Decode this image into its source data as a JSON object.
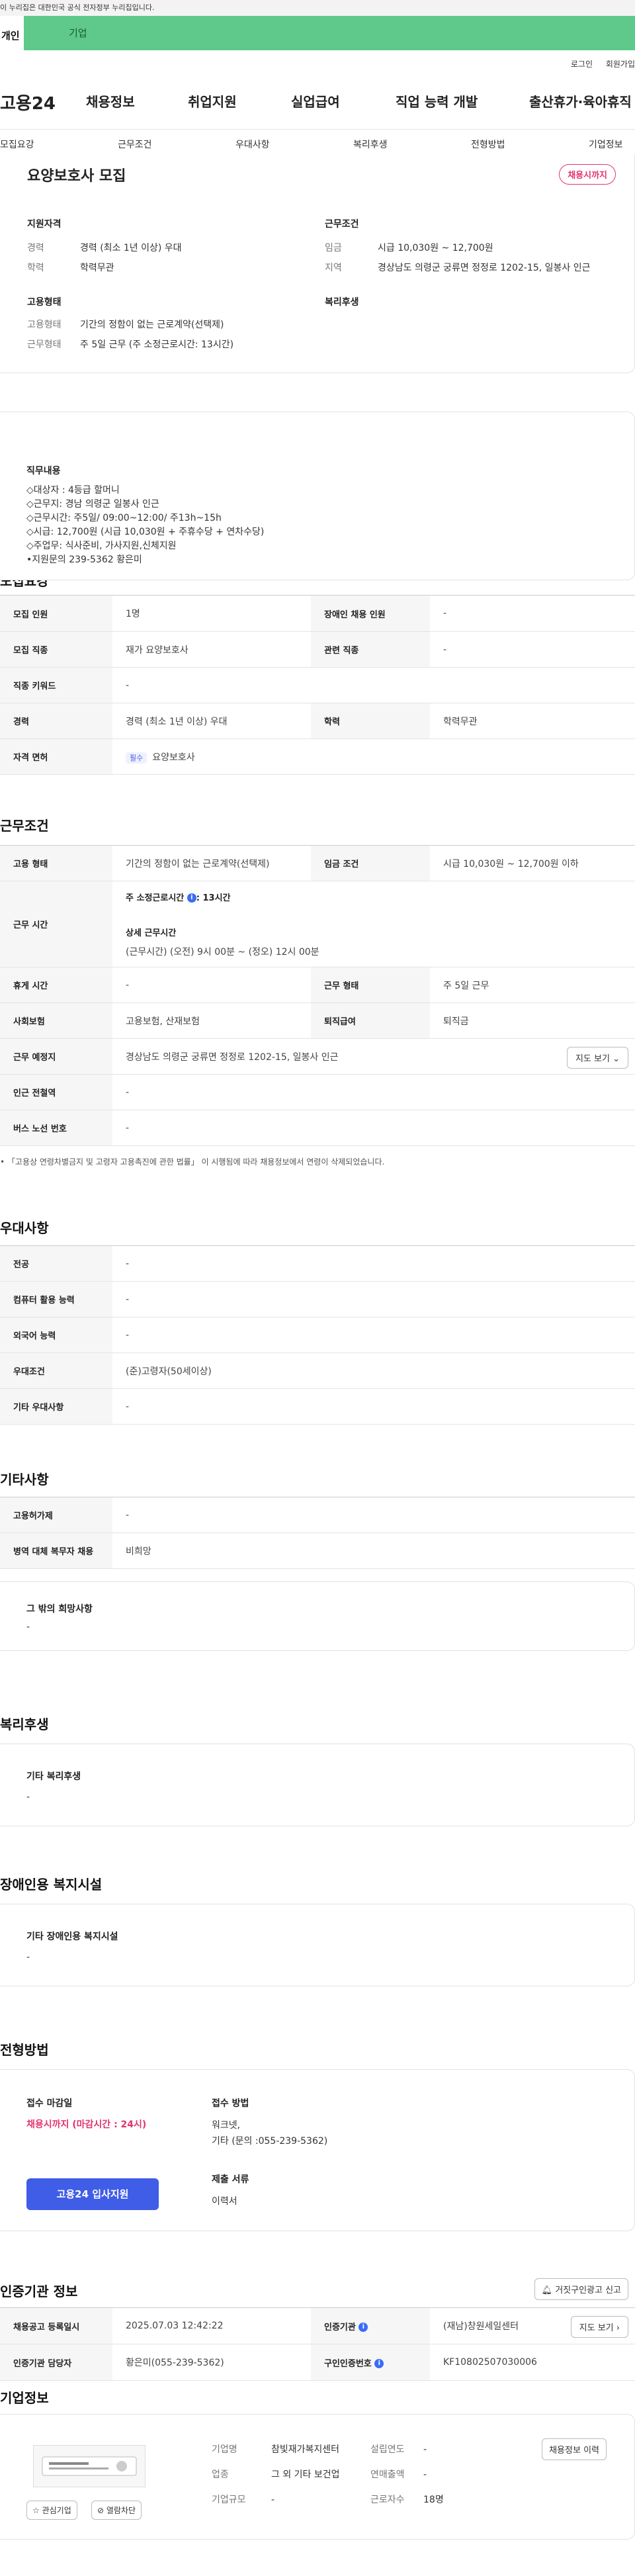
{
  "notice": "이 누리집은 대한민국 공식 전자정부 누리집입니다.",
  "usertabs": {
    "personal": "개인",
    "company": "기업"
  },
  "header": {
    "login": "로그인",
    "signup": "회원가입",
    "logo": "고용24",
    "gnb": [
      "채용정보",
      "취업지원",
      "실업급여",
      "직업 능력 개발",
      "출산휴가·육아휴직"
    ]
  },
  "subnav": [
    "모집요강",
    "근무조건",
    "우대사항",
    "복리후생",
    "전형방법",
    "기업정보"
  ],
  "summary": {
    "title": "요양보호사 모집",
    "status": "채용시까지",
    "qual_head": "지원자격",
    "qual": [
      {
        "k": "경력",
        "v": "경력 (최소 1년 이상) 우대"
      },
      {
        "k": "학력",
        "v": "학력무관"
      }
    ],
    "cond_head": "근무조건",
    "cond": [
      {
        "k": "임금",
        "v": "시급 10,030원 ~ 12,700원"
      },
      {
        "k": "지역",
        "v": "경상남도 의령군 궁류면 정정로 1202-15, 일봉사 인근"
      }
    ],
    "emp_head": "고용형태",
    "emp": [
      {
        "k": "고용형태",
        "v": "기간의 정함이 없는 근로계약(선택제)"
      },
      {
        "k": "근무형태",
        "v": "주 5일 근무 (주 소정근로시간: 13시간)"
      }
    ],
    "welfare_head": "복리후생"
  },
  "recruit": {
    "heading": "모집요강",
    "duty_head": "직무내용",
    "duty_lines": [
      "◇대상자 : 4등급 할머니",
      "◇근무지: 경남 의령군 일봉사 인근",
      "◇근무시간: 주5일/ 09:00~12:00/ 주13h~15h",
      "◇시급: 12,700원 (시급 10,030원 + 주휴수당 + 연차수당)",
      "◇주업무: 식사준비, 가사지원,신체지원",
      "•지원문의 239-5362 황은미"
    ],
    "rows": {
      "headcount_k": "모집 인원",
      "headcount_v": "1명",
      "disabled_k": "장애인 채용 인원",
      "disabled_v": "-",
      "job_k": "모집 직종",
      "job_v": "재가 요양보호사",
      "related_k": "관련 직종",
      "related_v": "-",
      "keyword_k": "직종 키워드",
      "keyword_v": "-",
      "career_k": "경력",
      "career_v": "경력 (최소 1년 이상) 우대",
      "edu_k": "학력",
      "edu_v": "학력무관",
      "license_k": "자격 면허",
      "license_badge": "필수",
      "license_v": "요양보호사"
    }
  },
  "work": {
    "heading": "근무조건",
    "emp_k": "고용 형태",
    "emp_v": "기간의 정함이 없는 근로계약(선택제)",
    "wage_k": "임금 조건",
    "wage_v": "시급 10,030원 ~ 12,700원 이하",
    "time_k": "근무 시간",
    "time_week": "주 소정근로시간",
    "time_week_v": ": 13시간",
    "time_detail_head": "상세 근무시간",
    "time_detail": "(근무시간) (오전) 9시 00분 ~ (정오) 12시 00분",
    "rest_k": "휴게 시간",
    "rest_v": "-",
    "form_k": "근무 형태",
    "form_v": "주 5일 근무",
    "ins_k": "사회보험",
    "ins_v": "고용보험, 산재보험",
    "retire_k": "퇴직급여",
    "retire_v": "퇴직금",
    "place_k": "근무 예정지",
    "place_v": "경상남도 의령군 궁류면 정정로 1202-15, 일봉사 인근",
    "map_btn": "지도 보기",
    "subway_k": "인근 전철역",
    "subway_v": "-",
    "bus_k": "버스 노선 번호",
    "bus_v": "-",
    "note": "「고용상 연령차별금지 및 고령자 고용촉진에 관한 법률」 이 시행됨에 따라 채용정보에서 연령이 삭제되었습니다."
  },
  "pref": {
    "heading": "우대사항",
    "rows": [
      {
        "k": "전공",
        "v": "-"
      },
      {
        "k": "컴퓨터 활용 능력",
        "v": "-"
      },
      {
        "k": "외국어 능력",
        "v": "-"
      },
      {
        "k": "우대조건",
        "v": "(준)고령자(50세이상)"
      },
      {
        "k": "기타 우대사항",
        "v": "-"
      }
    ]
  },
  "etc": {
    "heading": "기타사항",
    "rows": [
      {
        "k": "고용허가제",
        "v": "-"
      },
      {
        "k": "병역 대체 복무자 채용",
        "v": "비희망"
      }
    ],
    "other_head": "그 밖의 희망사항",
    "other_v": "-"
  },
  "welfare": {
    "heading": "복리후생",
    "box_head": "기타 복리후생",
    "box_v": "-"
  },
  "disab": {
    "heading": "장애인용 복지시설",
    "box_head": "기타 장애인용 복지시설",
    "box_v": "-"
  },
  "apply": {
    "heading": "전형방법",
    "deadline_head": "접수 마감일",
    "deadline_v": "채용시까지 (마감시간 : 24시)",
    "apply_btn": "고용24 입사지원",
    "method_head": "접수 방법",
    "method_lines": [
      "워크넷,",
      "기타 (문의 :055-239-5362)"
    ],
    "docs_head": "제출 서류",
    "docs_v": "이력서"
  },
  "cert": {
    "heading": "인증기관 정보",
    "report_btn": "거짓구인광고 신고",
    "reg_k": "채용공고 등록일시",
    "reg_v": "2025.07.03 12:42:22",
    "agency_k": "인증기관",
    "agency_v": "(재남)창원세일센터",
    "map_btn": "지도 보기",
    "manager_k": "인증기관 담당자",
    "manager_v": "황은미(055-239-5362)",
    "num_k": "구인인증번호",
    "num_v": "KF10802507030006"
  },
  "company": {
    "heading": "기업정보",
    "name_k": "기업명",
    "name_v": "참빛재가복지센터",
    "year_k": "설립연도",
    "year_v": "-",
    "ind_k": "업종",
    "ind_v": "그 외 기타 보건업",
    "sales_k": "연매출액",
    "sales_v": "-",
    "size_k": "기업규모",
    "size_v": "-",
    "emp_k": "근로자수",
    "emp_v": "18명",
    "history_btn": "채용정보 이력",
    "fav_btn": "관심기업",
    "block_btn": "열람차단"
  },
  "colors": {
    "brand_green": "#5ec98a",
    "apply_blue": "#3f5de6",
    "deadline_red": "#e4336b"
  }
}
